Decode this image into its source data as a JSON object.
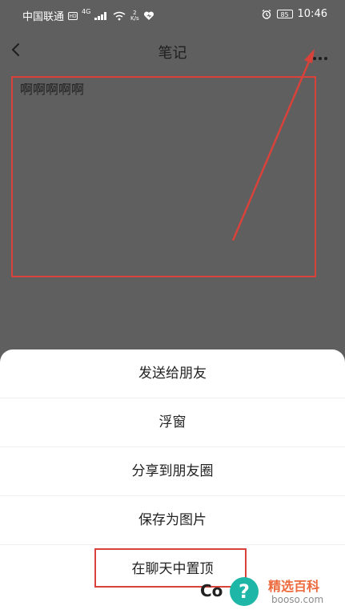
{
  "status_bar": {
    "carrier": "中国联通",
    "hd": "HD",
    "network": "4G",
    "speed_top": "2",
    "speed_bottom": "K/s",
    "battery": "85",
    "time": "10:46"
  },
  "header": {
    "title": "笔记"
  },
  "note": {
    "text": "啊啊啊啊啊"
  },
  "menu": {
    "items": [
      {
        "label": "发送给朋友"
      },
      {
        "label": "浮窗"
      },
      {
        "label": "分享到朋友圈"
      },
      {
        "label": "保存为图片"
      },
      {
        "label": "在聊天中置顶"
      }
    ]
  },
  "footer": {
    "fragment": "Co"
  },
  "watermark": {
    "mark": "?",
    "title": "精选百科",
    "url": "booso.com"
  },
  "colors": {
    "accent_red": "#d9423b",
    "overlay_gray": "#5f5f5f",
    "sheet_white": "#ffffff",
    "watermark_teal": "#1db6a7",
    "watermark_orange": "#ec6a3d"
  },
  "icons": {
    "back": "chevron-left-icon",
    "more": "more-horizontal-icon",
    "alarm": "alarm-icon",
    "wifi": "wifi-icon",
    "heart": "heart-icon"
  }
}
